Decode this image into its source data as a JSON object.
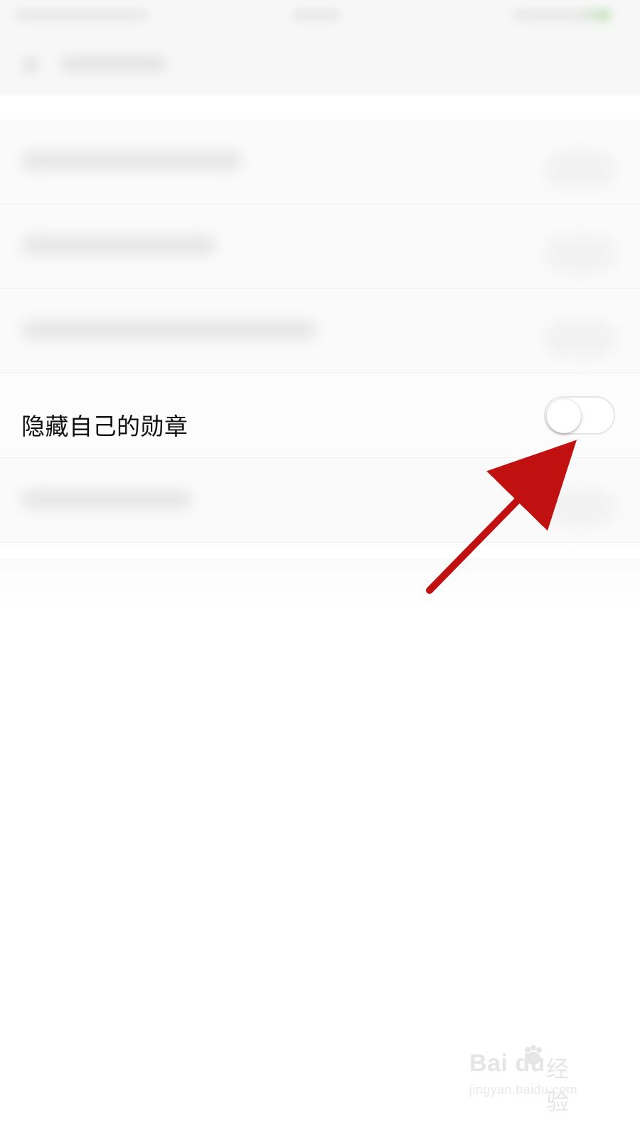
{
  "settings": {
    "focused_row": {
      "label": "隐藏自己的勋章",
      "toggle_on": false
    }
  },
  "watermark": {
    "logo_text": "Bai du",
    "cn_text": "经验",
    "url": "jingyan.baidu.com"
  },
  "colors": {
    "arrow": "#c01010",
    "toggle_border": "#e5e5e5"
  },
  "icons": {
    "back": "chevron-left-icon",
    "annotation_arrow": "red-arrow-icon",
    "paw": "paw-icon"
  }
}
